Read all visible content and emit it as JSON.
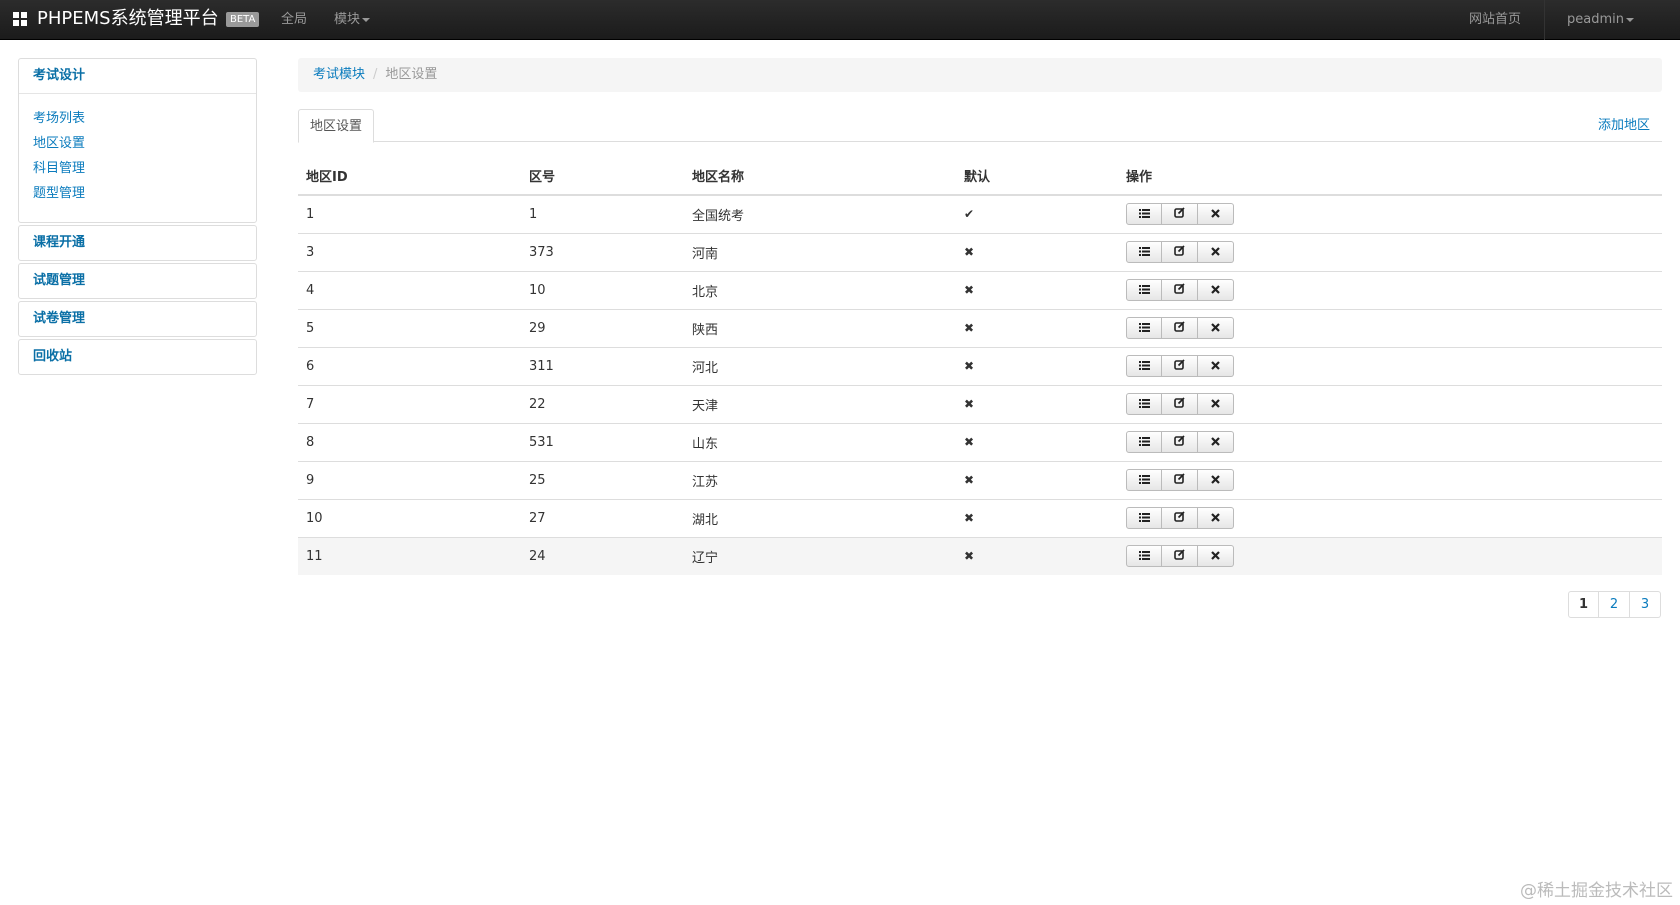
{
  "navbar": {
    "brand": "PHPEMS系统管理平台",
    "badge": "BETA",
    "links": [
      "全局",
      "模块"
    ],
    "right_link": "网站首页",
    "user": "peadmin"
  },
  "sidebar": {
    "sections": [
      {
        "title": "考试设计",
        "items": [
          "考场列表",
          "地区设置",
          "科目管理",
          "题型管理"
        ]
      },
      {
        "title": "课程开通"
      },
      {
        "title": "试题管理"
      },
      {
        "title": "试卷管理"
      },
      {
        "title": "回收站"
      }
    ]
  },
  "breadcrumb": {
    "parent": "考试模块",
    "sep": "/",
    "current": "地区设置"
  },
  "tabs": {
    "active": "地区设置",
    "add_label": "添加地区"
  },
  "table": {
    "headers": [
      "地区ID",
      "区号",
      "地区名称",
      "默认",
      "操作"
    ],
    "rows": [
      {
        "id": "1",
        "code": "1",
        "name": "全国统考",
        "default": "✔"
      },
      {
        "id": "3",
        "code": "373",
        "name": "河南",
        "default": "✖"
      },
      {
        "id": "4",
        "code": "10",
        "name": "北京",
        "default": "✖"
      },
      {
        "id": "5",
        "code": "29",
        "name": "陕西",
        "default": "✖"
      },
      {
        "id": "6",
        "code": "311",
        "name": "河北",
        "default": "✖"
      },
      {
        "id": "7",
        "code": "22",
        "name": "天津",
        "default": "✖"
      },
      {
        "id": "8",
        "code": "531",
        "name": "山东",
        "default": "✖"
      },
      {
        "id": "9",
        "code": "25",
        "name": "江苏",
        "default": "✖"
      },
      {
        "id": "10",
        "code": "27",
        "name": "湖北",
        "default": "✖"
      },
      {
        "id": "11",
        "code": "24",
        "name": "辽宁",
        "default": "✖"
      }
    ],
    "action_icons": [
      "list-icon",
      "edit-icon",
      "delete-icon"
    ]
  },
  "pagination": {
    "pages": [
      "1",
      "2",
      "3"
    ],
    "current": "1"
  },
  "watermark": "@稀土掘金技术社区"
}
